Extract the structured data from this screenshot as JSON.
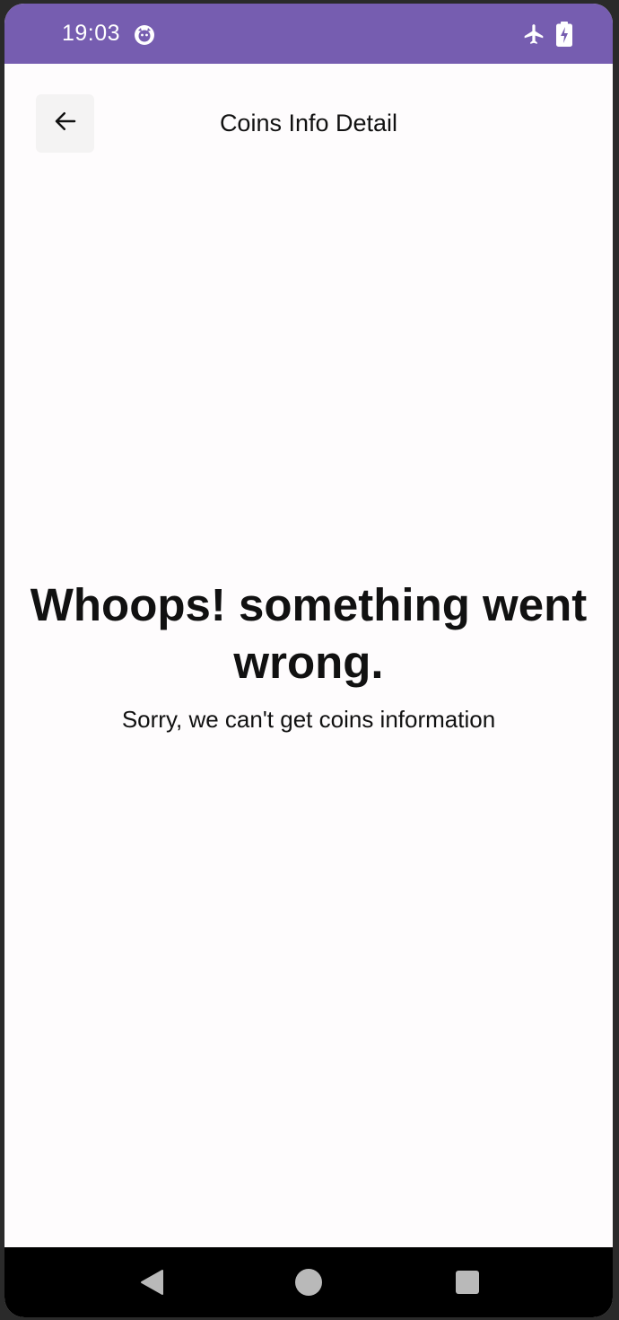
{
  "status_bar": {
    "time": "19:03",
    "app_icon": "notification-app-icon",
    "airplane_icon": "airplane-mode-icon",
    "battery_icon": "battery-charging-icon",
    "color": "#765db0"
  },
  "top_bar": {
    "back_icon": "arrow-left-icon",
    "title": "Coins Info Detail"
  },
  "error": {
    "title": "Whoops! something went wrong.",
    "message": "Sorry, we can't get coins information"
  },
  "nav_bar": {
    "back_icon": "nav-back-icon",
    "home_icon": "nav-home-icon",
    "recents_icon": "nav-recents-icon"
  }
}
